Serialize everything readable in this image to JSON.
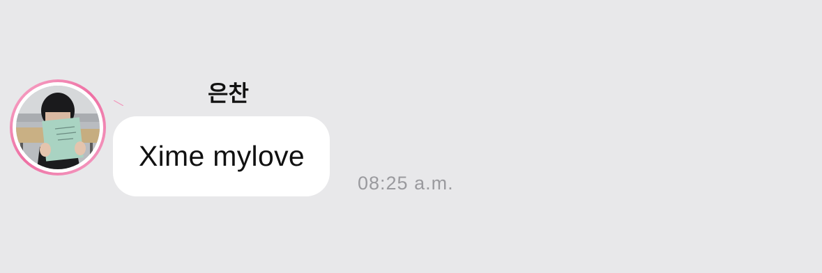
{
  "message": {
    "sender": {
      "name": "은찬",
      "avatar": "profile-photo-person-reading-book",
      "ring_color": "#ee6fa3"
    },
    "text": "Xime mylove",
    "time": "08:25 a.m."
  },
  "colors": {
    "background": "#e8e8ea",
    "bubble": "#ffffff",
    "text": "#111111",
    "timestamp": "#9a9a9e"
  }
}
